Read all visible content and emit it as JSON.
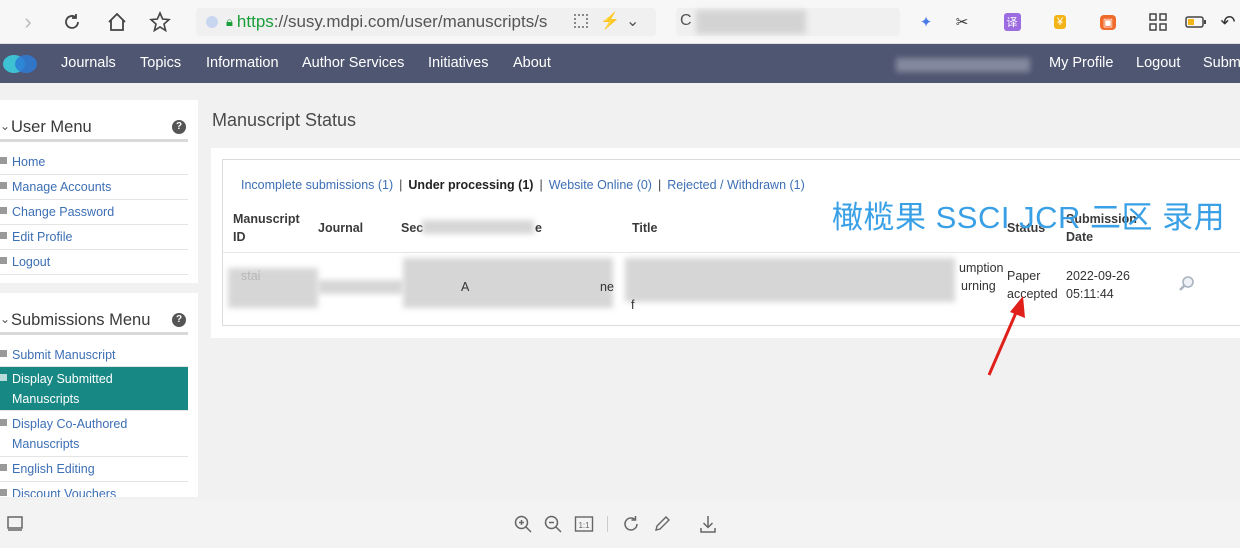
{
  "browser": {
    "url_scheme": "https",
    "url_rest": "://susy.mdpi.com/user/manuscripts/s",
    "search_prefix": "C"
  },
  "navbar": {
    "items": [
      "Journals",
      "Topics",
      "Information",
      "Author Services",
      "Initiatives",
      "About"
    ],
    "right": [
      "My Profile",
      "Logout",
      "Subm"
    ]
  },
  "user_menu": {
    "title": "User Menu",
    "help": "?",
    "items": [
      "Home",
      "Manage Accounts",
      "Change Password",
      "Edit Profile",
      "Logout"
    ]
  },
  "submissions_menu": {
    "title": "Submissions Menu",
    "help": "?",
    "items": [
      "Submit Manuscript",
      "Display Submitted Manuscripts",
      "Display Co-Authored Manuscripts",
      "English Editing",
      "Discount Vouchers"
    ],
    "active_index": 1
  },
  "main": {
    "title": "Manuscript Status",
    "tabs": {
      "incomplete": "Incomplete submissions (1)",
      "processing": "Under processing (1)",
      "online": "Website Online (0)",
      "rejected": "Rejected / Withdrawn (1)",
      "separator": "|"
    },
    "columns": {
      "id": "Manuscript ID",
      "journal": "Journal",
      "section_partial": "Sec",
      "section_tail": "e",
      "title": "Title",
      "status": "Status",
      "date": "Submission Date"
    },
    "row": {
      "id_partial": "stai",
      "section_partial": "A",
      "section_mid": "ne",
      "title_partial": "f",
      "title_tail_1": "umption",
      "title_tail_2": "urning",
      "status": "Paper accepted",
      "date": "2022-09-26",
      "time": "05:11:44"
    }
  },
  "annotation": {
    "text": "橄榄果 SSCI JCR 二区 录用",
    "color": "#3aa0e6",
    "arrow_color": "#e0201a"
  },
  "colors": {
    "navbar": "#4f5671",
    "active_menu": "#178884",
    "link": "#3d6fb5"
  }
}
